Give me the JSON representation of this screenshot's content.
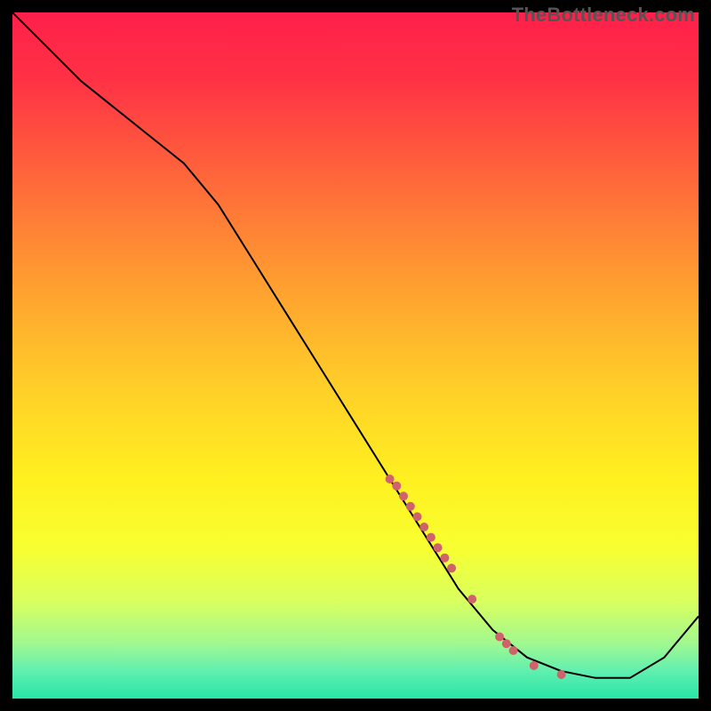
{
  "watermark": "TheBottleneck.com",
  "chart_data": {
    "type": "line",
    "title": "",
    "xlabel": "",
    "ylabel": "",
    "xlim": [
      0,
      100
    ],
    "ylim": [
      0,
      100
    ],
    "grid": false,
    "legend": false,
    "series": [
      {
        "name": "curve",
        "x": [
          0,
          5,
          10,
          15,
          20,
          25,
          30,
          35,
          40,
          45,
          50,
          55,
          60,
          65,
          70,
          75,
          80,
          85,
          90,
          95,
          100
        ],
        "y": [
          100,
          95,
          90,
          86,
          82,
          78,
          72,
          64,
          56,
          48,
          40,
          32,
          24,
          16,
          10,
          6,
          4,
          3,
          3,
          6,
          12
        ],
        "color": "#000000"
      }
    ],
    "highlight_points": {
      "name": "markers",
      "color": "#d0626c",
      "points": [
        {
          "x": 55,
          "y": 32,
          "r": 5
        },
        {
          "x": 56,
          "y": 31,
          "r": 5
        },
        {
          "x": 57,
          "y": 29.5,
          "r": 5
        },
        {
          "x": 58,
          "y": 28,
          "r": 5
        },
        {
          "x": 59,
          "y": 26.5,
          "r": 5
        },
        {
          "x": 60,
          "y": 25,
          "r": 5
        },
        {
          "x": 61,
          "y": 23.5,
          "r": 5
        },
        {
          "x": 62,
          "y": 22,
          "r": 5
        },
        {
          "x": 63,
          "y": 20.5,
          "r": 5
        },
        {
          "x": 64,
          "y": 19,
          "r": 5
        },
        {
          "x": 67,
          "y": 14.5,
          "r": 5
        },
        {
          "x": 71,
          "y": 9,
          "r": 5
        },
        {
          "x": 72,
          "y": 8,
          "r": 5
        },
        {
          "x": 73,
          "y": 7,
          "r": 5
        },
        {
          "x": 76,
          "y": 4.8,
          "r": 5
        },
        {
          "x": 80,
          "y": 3.5,
          "r": 5
        }
      ]
    },
    "background_gradient": {
      "stops": [
        {
          "offset": 0.0,
          "color": "#ff1f4a"
        },
        {
          "offset": 0.1,
          "color": "#ff3245"
        },
        {
          "offset": 0.25,
          "color": "#ff6a3a"
        },
        {
          "offset": 0.4,
          "color": "#ffa030"
        },
        {
          "offset": 0.55,
          "color": "#ffd028"
        },
        {
          "offset": 0.68,
          "color": "#fff020"
        },
        {
          "offset": 0.78,
          "color": "#f8ff30"
        },
        {
          "offset": 0.86,
          "color": "#d8ff60"
        },
        {
          "offset": 0.92,
          "color": "#a0f890"
        },
        {
          "offset": 0.96,
          "color": "#60efb0"
        },
        {
          "offset": 1.0,
          "color": "#28e6a6"
        }
      ]
    }
  }
}
